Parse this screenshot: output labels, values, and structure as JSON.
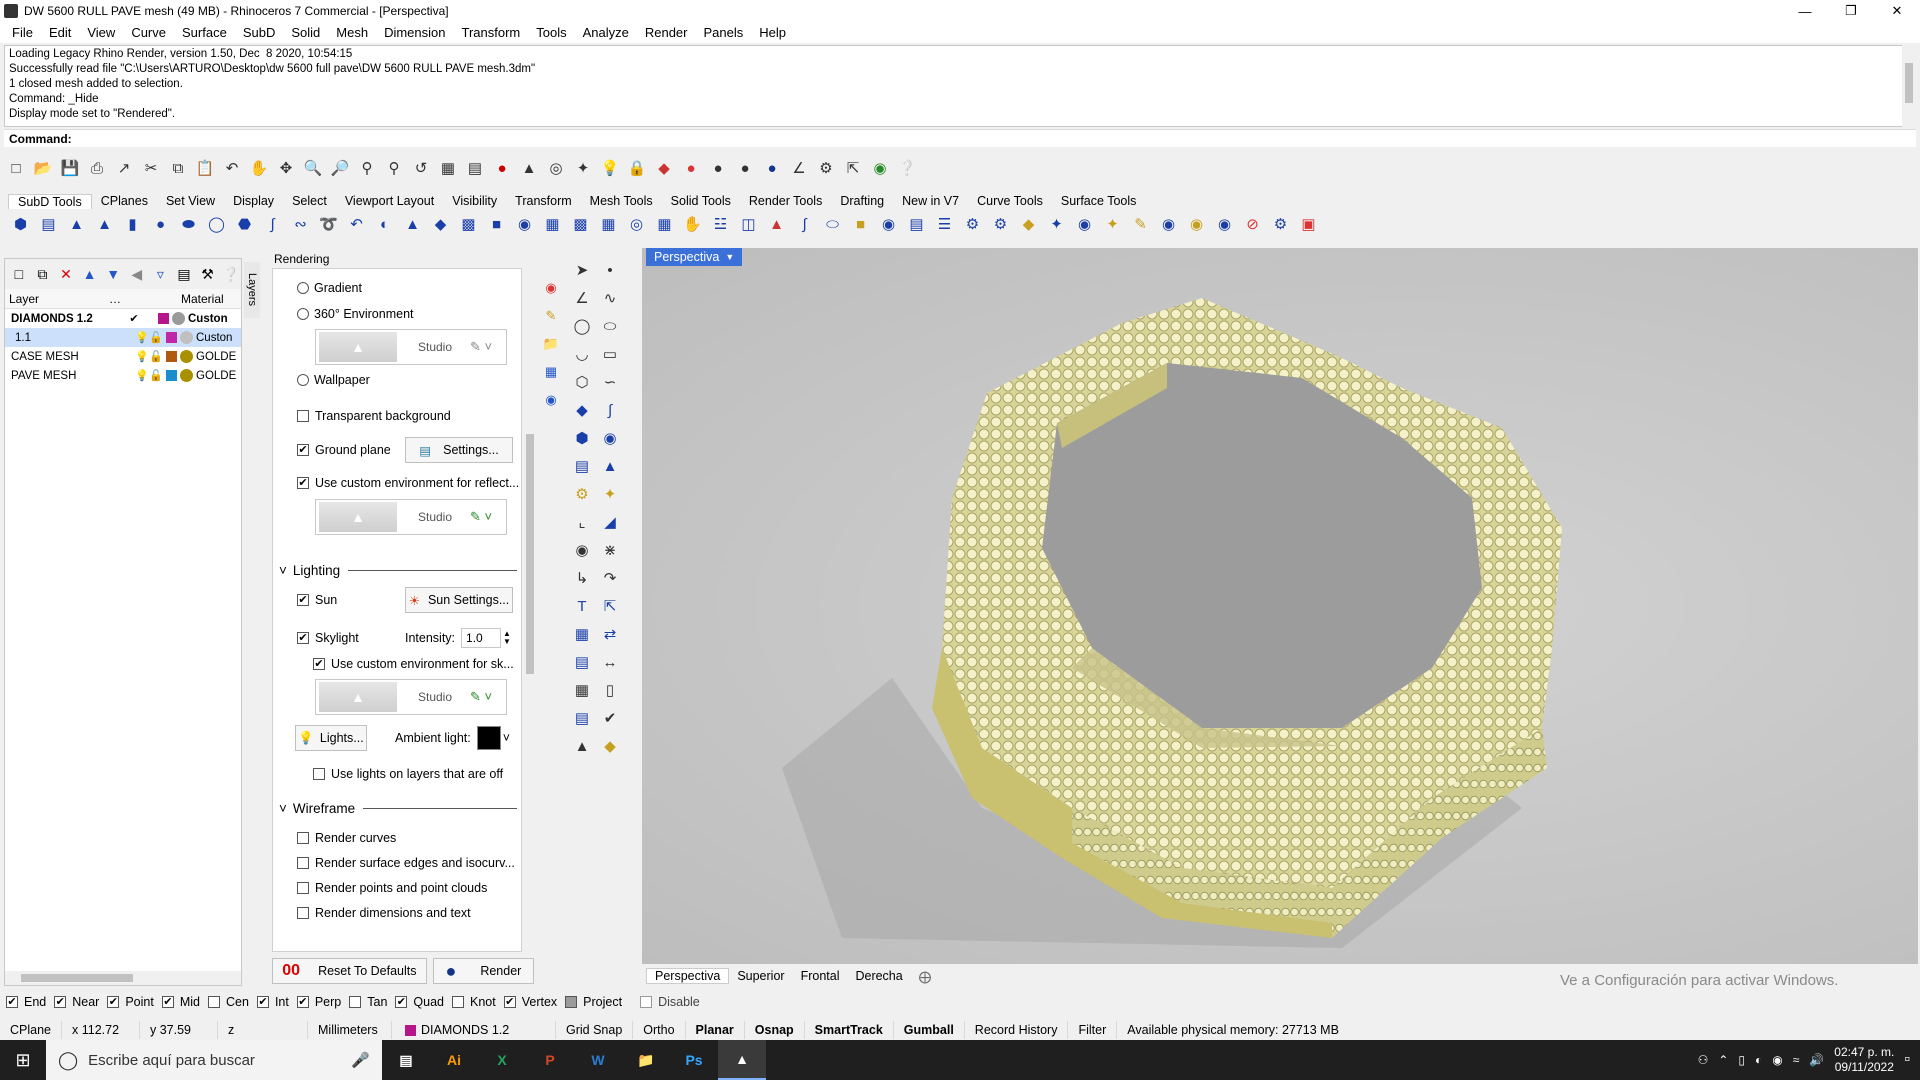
{
  "window": {
    "title": "DW 5600 RULL PAVE mesh (49 MB) - Rhinoceros 7 Commercial - [Perspectiva]"
  },
  "menu": [
    "File",
    "Edit",
    "View",
    "Curve",
    "Surface",
    "SubD",
    "Solid",
    "Mesh",
    "Dimension",
    "Transform",
    "Tools",
    "Analyze",
    "Render",
    "Panels",
    "Help"
  ],
  "history": {
    "lines": [
      "Loading Legacy Rhino Render, version 1.50, Dec  8 2020, 10:54:15",
      "Successfully read file \"C:\\Users\\ARTURO\\Desktop\\dw 5600 full pave\\DW 5600 RULL PAVE mesh.3dm\"",
      "1 closed mesh added to selection.",
      "Command: _Hide",
      "Display mode set to \"Rendered\"."
    ]
  },
  "command": {
    "label": "Command:"
  },
  "tabs": [
    "SubD Tools",
    "CPlanes",
    "Set View",
    "Display",
    "Select",
    "Viewport Layout",
    "Visibility",
    "Transform",
    "Mesh Tools",
    "Solid Tools",
    "Render Tools",
    "Drafting",
    "New in V7",
    "Curve Tools",
    "Surface Tools"
  ],
  "layers": {
    "columns": {
      "layer": "Layer",
      "material": "Material"
    },
    "rows": [
      {
        "name": "DIAMONDS 1.2",
        "material": "Custon",
        "color": "#b5178a",
        "matcolor": "#9a9a9a",
        "selected": false,
        "current": true
      },
      {
        "name": "1.1",
        "material": "Custon",
        "color": "#c026a8",
        "matcolor": "#c0c0c0",
        "selected": true,
        "current": false
      },
      {
        "name": "CASE MESH",
        "material": "GOLDE",
        "color": "#b05a10",
        "matcolor": "#a89000",
        "selected": false,
        "current": false
      },
      {
        "name": "PAVE MESH",
        "material": "GOLDE",
        "color": "#1a8fd0",
        "matcolor": "#a89000",
        "selected": false,
        "current": false
      }
    ],
    "sidetab": "Layers"
  },
  "rendering": {
    "title": "Rendering",
    "gradient": "Gradient",
    "env360": "360° Environment",
    "studio": "Studio",
    "wallpaper": "Wallpaper",
    "transparent_bg": "Transparent background",
    "ground_plane": "Ground plane",
    "settings": "Settings...",
    "custom_env_reflect": "Use custom environment for reflect...",
    "lighting": "Lighting",
    "sun": "Sun",
    "sun_settings": "Sun Settings...",
    "skylight": "Skylight",
    "intensity_label": "Intensity:",
    "intensity_value": "1.0",
    "custom_env_sky": "Use custom environment for sk...",
    "lights": "Lights...",
    "ambient": "Ambient light:",
    "lights_on_off": "Use lights on layers that are off",
    "wireframe": "Wireframe",
    "render_curves": "Render curves",
    "render_surface_edges": "Render surface edges and isocurv...",
    "render_points": "Render points and point clouds",
    "render_dims": "Render dimensions and text",
    "reset": "Reset To Defaults",
    "render": "Render"
  },
  "viewport": {
    "label": "Perspectiva",
    "tabs": [
      "Perspectiva",
      "Superior",
      "Frontal",
      "Derecha"
    ],
    "activate_windows": "Ve a Configuración para activar Windows."
  },
  "osnap": {
    "items": [
      {
        "label": "End",
        "checked": true
      },
      {
        "label": "Near",
        "checked": true
      },
      {
        "label": "Point",
        "checked": true
      },
      {
        "label": "Mid",
        "checked": true
      },
      {
        "label": "Cen",
        "checked": false
      },
      {
        "label": "Int",
        "checked": true
      },
      {
        "label": "Perp",
        "checked": true
      },
      {
        "label": "Tan",
        "checked": false
      },
      {
        "label": "Quad",
        "checked": true
      },
      {
        "label": "Knot",
        "checked": false
      },
      {
        "label": "Vertex",
        "checked": true
      }
    ],
    "project": "Project",
    "disable": "Disable"
  },
  "status": {
    "cplane": "CPlane",
    "x": "x 112.72",
    "y": "y 37.59",
    "z": "z",
    "units": "Millimeters",
    "layer": "DIAMONDS 1.2",
    "gridsnap": "Grid Snap",
    "ortho": "Ortho",
    "planar": "Planar",
    "osnap": "Osnap",
    "smarttrack": "SmartTrack",
    "gumball": "Gumball",
    "record": "Record History",
    "filter": "Filter",
    "memory": "Available physical memory: 27713 MB"
  },
  "taskbar": {
    "search": "Escribe aquí para buscar",
    "time": "02:47 p. m.",
    "date": "09/11/2022"
  },
  "colors": {
    "accent": "#3b70d8",
    "gold": "#e7e3a6"
  }
}
